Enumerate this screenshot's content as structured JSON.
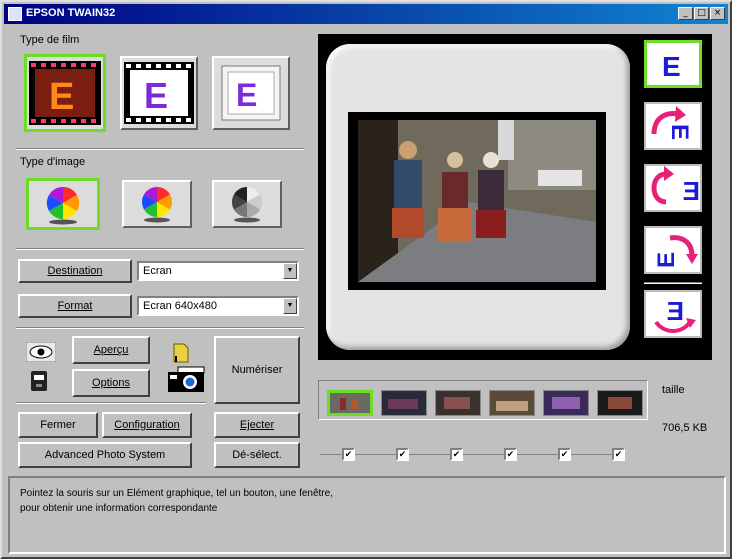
{
  "window": {
    "title": "EPSON TWAIN32"
  },
  "film_type": {
    "label": "Type de film",
    "options": [
      {
        "name": "film-negative",
        "selected": true
      },
      {
        "name": "film-positive",
        "selected": false
      },
      {
        "name": "film-slide",
        "selected": false
      }
    ]
  },
  "image_type": {
    "label": "Type d'image",
    "options": [
      {
        "name": "color",
        "selected": true
      },
      {
        "name": "color-alt",
        "selected": false
      },
      {
        "name": "grayscale",
        "selected": false
      }
    ]
  },
  "destination": {
    "label": "Destination",
    "value": "Ecran"
  },
  "format": {
    "label": "Format",
    "value": "Ecran 640x480"
  },
  "buttons": {
    "apercu": "Aperçu",
    "options": "Options",
    "numeriser": "Numériser",
    "fermer": "Fermer",
    "configuration": "Configuration",
    "ejecter": "Ejecter",
    "aps": "Advanced Photo System",
    "deselect": "Dé-sélect."
  },
  "thumbnails": {
    "count": 6,
    "selected_index": 0,
    "checked": [
      true,
      true,
      true,
      true,
      true,
      true
    ]
  },
  "size": {
    "label": "taille",
    "value": "706,5 KB"
  },
  "status": {
    "line1": "Pointez la souris sur un Elément graphique, tel un bouton, une fenêtre,",
    "line2": "pour obtenir une information correspondante"
  },
  "colors": {
    "accent_green": "#6fdc28",
    "title_blue": "#000080",
    "rotate_pink": "#e8207a",
    "rotate_blue": "#1a1ad8"
  }
}
